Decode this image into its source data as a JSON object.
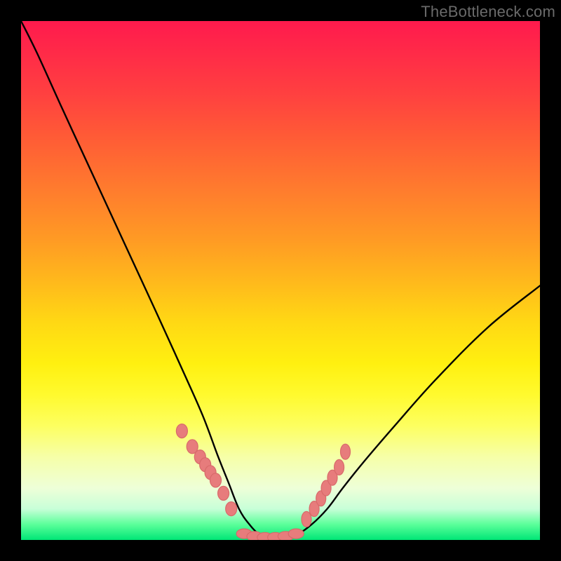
{
  "watermark": "TheBottleneck.com",
  "colors": {
    "frame": "#000000",
    "curve": "#000000",
    "marker_fill": "#e77c7c",
    "marker_stroke": "#d86a6a"
  },
  "chart_data": {
    "type": "line",
    "title": "",
    "xlabel": "",
    "ylabel": "",
    "xlim": [
      0,
      100
    ],
    "ylim": [
      0,
      100
    ],
    "grid": false,
    "legend": false,
    "note": "Values estimated from pixel positions; y interpreted as bottleneck percentage (0 at bottom / green, 100 at top / red).",
    "series": [
      {
        "name": "bottleneck-curve",
        "x": [
          0,
          3,
          8,
          14,
          20,
          26,
          31,
          35,
          38,
          40,
          42,
          44,
          46,
          48,
          50,
          53,
          56,
          59,
          62,
          66,
          72,
          80,
          90,
          100
        ],
        "y": [
          100,
          94,
          83,
          70,
          57,
          44,
          33,
          24,
          16,
          11,
          6,
          3,
          1,
          0.5,
          0.5,
          1,
          3,
          6,
          10,
          15,
          22,
          31,
          41,
          49
        ]
      }
    ],
    "markers": {
      "note": "Salmon point-clusters along the curve near the valley",
      "left_cluster_x": [
        31,
        33,
        34.5,
        35.5,
        36.5,
        37.5,
        39,
        40.5
      ],
      "left_cluster_y": [
        21,
        18,
        16,
        14.5,
        13,
        11.5,
        9,
        6
      ],
      "bottom_cluster_x": [
        43,
        45,
        47,
        49,
        51,
        53
      ],
      "bottom_cluster_y": [
        1.2,
        0.7,
        0.5,
        0.5,
        0.7,
        1.2
      ],
      "right_cluster_x": [
        55,
        56.5,
        57.8,
        58.8,
        60,
        61.3,
        62.5
      ],
      "right_cluster_y": [
        4,
        6,
        8,
        10,
        12,
        14,
        17
      ]
    }
  }
}
